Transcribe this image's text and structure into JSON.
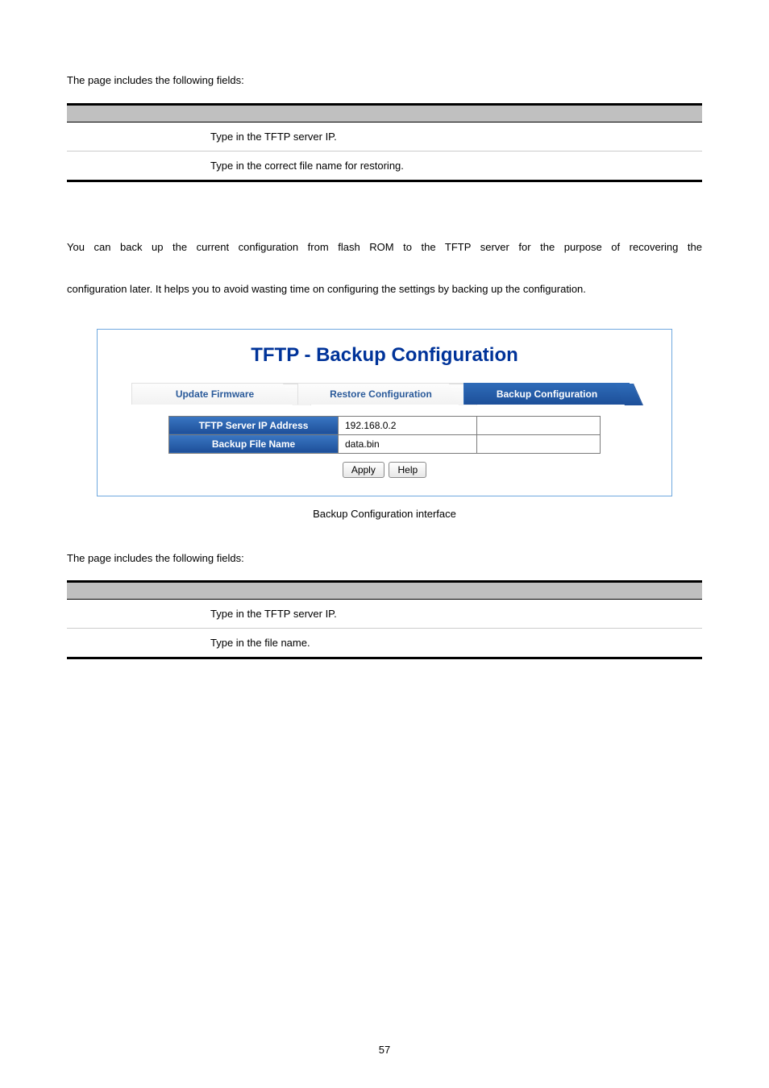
{
  "intro1": "The page includes the following fields:",
  "table1": {
    "header_col1": "",
    "header_col2": "",
    "rows": [
      {
        "label": "",
        "desc": "Type in the TFTP server IP."
      },
      {
        "label": "",
        "desc": "Type in the correct file name for restoring."
      }
    ]
  },
  "section_desc": "You can back up the current configuration from flash ROM to the TFTP server for the purpose of recovering the configuration later. It helps you to avoid wasting time on configuring the settings by backing up the configuration.",
  "figure": {
    "title": "TFTP - Backup Configuration",
    "tabs": [
      {
        "label": "Update Firmware",
        "active": false
      },
      {
        "label": "Restore Configuration",
        "active": false
      },
      {
        "label": "Backup Configuration",
        "active": true
      }
    ],
    "rows": [
      {
        "label": "TFTP Server IP Address",
        "value": "192.168.0.2"
      },
      {
        "label": "Backup File Name",
        "value": "data.bin"
      }
    ],
    "buttons": {
      "apply": "Apply",
      "help": "Help"
    }
  },
  "caption": "Backup Configuration interface",
  "intro2": "The page includes the following fields:",
  "table2": {
    "header_col1": "",
    "header_col2": "",
    "rows": [
      {
        "label": "",
        "desc": "Type in the TFTP server IP."
      },
      {
        "label": "",
        "desc": "Type in the file name."
      }
    ]
  },
  "page_number": "57"
}
